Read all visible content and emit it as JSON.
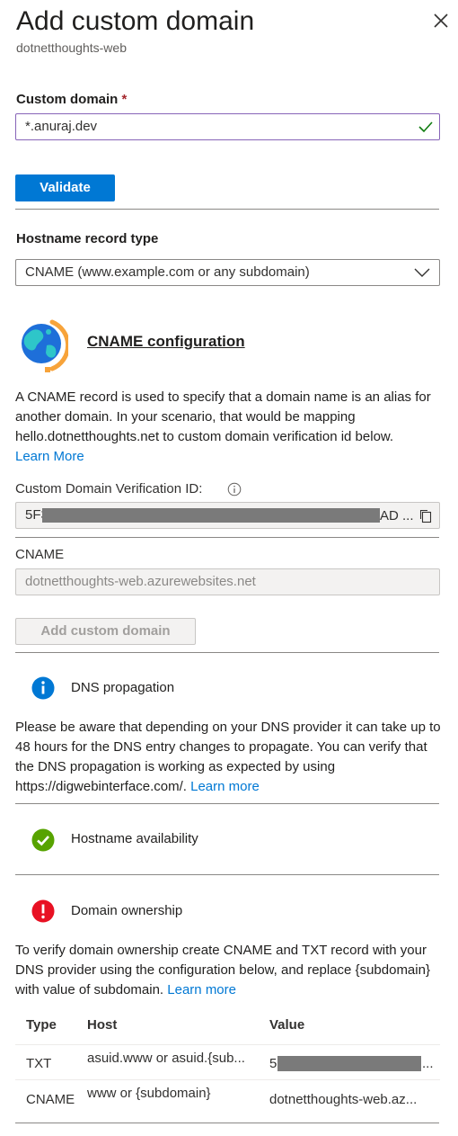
{
  "header": {
    "title": "Add custom domain",
    "subtitle": "dotnetthoughts-web"
  },
  "custom_domain": {
    "label": "Custom domain",
    "required_marker": "*",
    "value": "*.anuraj.dev"
  },
  "validate_button": "Validate",
  "hostname_record": {
    "label": "Hostname record type",
    "selected": "CNAME (www.example.com or any subdomain)"
  },
  "cname_config": {
    "heading": "CNAME configuration",
    "description": "A CNAME record is used to specify that a domain name is an alias for another domain. In your scenario, that would be mapping hello.dotnetthoughts.net to custom domain verification id below.",
    "learn_more": "Learn More",
    "verification_label": "Custom Domain Verification ID:",
    "verification_prefix": "5F3",
    "verification_suffix": "AD ...",
    "cname_label": "CNAME",
    "cname_value": "dotnetthoughts-web.azurewebsites.net"
  },
  "add_domain_button": "Add custom domain",
  "dns_propagation": {
    "title": "DNS propagation",
    "text": "Please be aware that depending on your DNS provider it can take up to 48 hours for the DNS entry changes to propagate. You can verify that the DNS propagation is working as expected by using https://digwebinterface.com/.",
    "learn_more": "Learn more"
  },
  "hostname_availability": {
    "title": "Hostname availability"
  },
  "domain_ownership": {
    "title": "Domain ownership",
    "text": "To verify domain ownership create CNAME and TXT record with your DNS provider using the configuration below, and replace {subdomain} with value of subdomain.",
    "learn_more": "Learn more"
  },
  "records_table": {
    "headers": [
      "Type",
      "Host",
      "Value"
    ],
    "rows": [
      {
        "type": "TXT",
        "host": "asuid.www or asuid.{sub...",
        "value": "5",
        "value_suffix": "..."
      },
      {
        "type": "CNAME",
        "host": "www or {subdomain}",
        "value": "dotnetthoughts-web.az...",
        "value_suffix": ""
      }
    ]
  },
  "colors": {
    "accent": "#0078d4",
    "success": "#57a300",
    "error": "#e81123",
    "focus_border": "#8764b8"
  }
}
